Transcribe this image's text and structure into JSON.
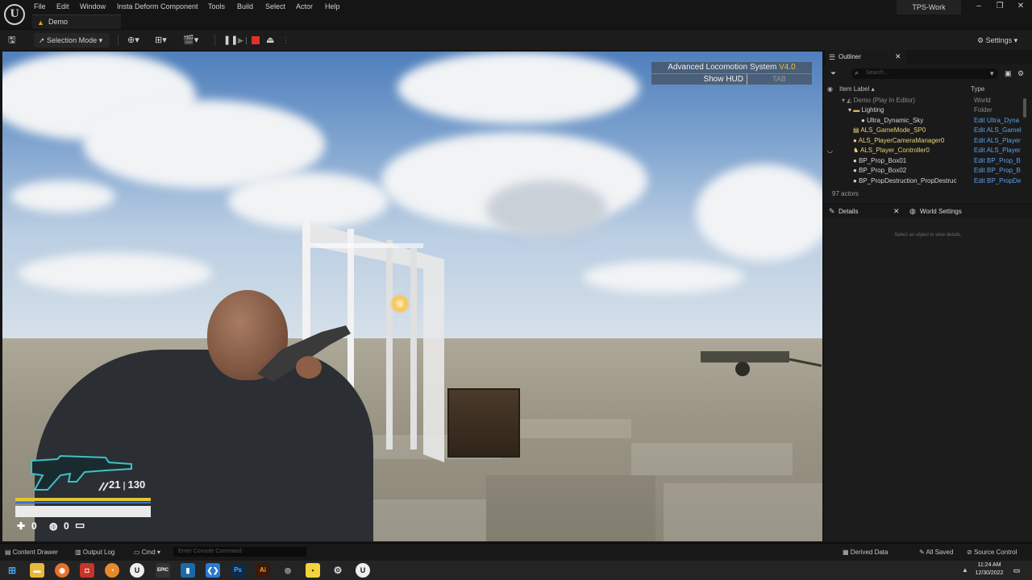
{
  "menubar": {
    "items": [
      "File",
      "Edit",
      "Window",
      "Insta Deform Component",
      "Tools",
      "Build",
      "Select",
      "Actor",
      "Help"
    ],
    "project": "TPS-Work",
    "logo": "unreal-logo",
    "window_controls": [
      "minimize",
      "maximize",
      "close"
    ]
  },
  "document_tab": {
    "label": "Demo",
    "icon": "level-icon"
  },
  "toolbar": {
    "selection_mode": "Selection Mode",
    "settings_label": "Settings",
    "stop_color": "#e0302a"
  },
  "viewport_hud": {
    "als_title": "Advanced Locomotion System",
    "als_version": "V4.0",
    "show_hud": "Show HUD",
    "show_hud_key": "TAB",
    "ammo_clip": "21",
    "ammo_reserve": "130",
    "health_count": "0",
    "grenade_count": "0",
    "accent_color": "#3fc0c8"
  },
  "outliner": {
    "tab_label": "Outliner",
    "search_placeholder": "Search...",
    "col_item_label": "Item Label",
    "col_type": "Type",
    "rows": [
      {
        "label": "Demo (Play In Editor)",
        "type": "World",
        "indent": 0
      },
      {
        "label": "Lighting",
        "type": "Folder",
        "indent": 1
      },
      {
        "label": "Ultra_Dynamic_Sky",
        "type": "Edit Ultra_Dyna",
        "indent": 2
      },
      {
        "label": "ALS_GameMode_SP0",
        "type": "Edit ALS_Gamel",
        "indent": 1
      },
      {
        "label": "ALS_PlayerCameraManager0",
        "type": "Edit ALS_Player",
        "indent": 1
      },
      {
        "label": "ALS_Player_Controller0",
        "type": "Edit ALS_Player",
        "indent": 1
      },
      {
        "label": "BP_Prop_Box01",
        "type": "Edit BP_Prop_B",
        "indent": 1
      },
      {
        "label": "BP_Prop_Box02",
        "type": "Edit BP_Prop_B",
        "indent": 1
      },
      {
        "label": "BP_PropDestruction_PropDestruc",
        "type": "Edit BP_PropDe",
        "indent": 1
      }
    ],
    "actor_count": "97 actors"
  },
  "details": {
    "tab_label": "Details",
    "world_settings_label": "World Settings",
    "hint": "Select an object to view details."
  },
  "statusbar": {
    "content_drawer": "Content Drawer",
    "output_log": "Output Log",
    "cmd": "Cmd",
    "console_placeholder": "Enter Console Command",
    "derived_data": "Derived Data",
    "all_saved": "All Saved",
    "source_control": "Source Control"
  },
  "taskbar": {
    "time": "11:24 AM",
    "date": "12/30/2022",
    "apps": [
      "windows-start",
      "file-explorer",
      "firefox",
      "game-app",
      "blender",
      "unreal-engine",
      "epic-games",
      "app-window",
      "vscode",
      "photoshop",
      "illustrator",
      "circle-app",
      "sticky-notes",
      "settings",
      "unreal-engine-2"
    ]
  }
}
